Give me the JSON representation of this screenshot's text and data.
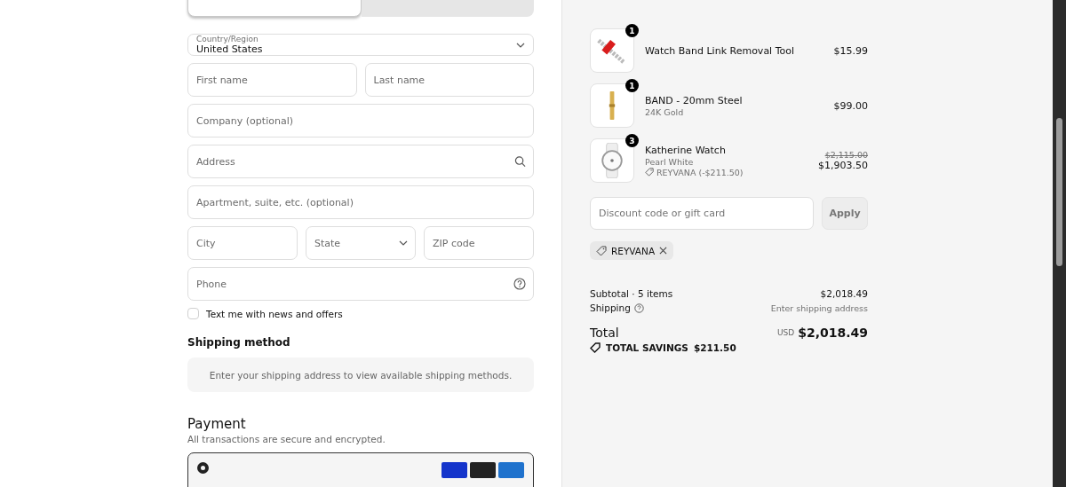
{
  "delivery_tabs": [
    {
      "selected": true
    },
    {
      "selected": false
    }
  ],
  "country": {
    "label": "Country/Region",
    "value": "United States"
  },
  "field_rows": [
    [
      {
        "kind": "text",
        "placeholder": "First name"
      },
      {
        "kind": "text",
        "placeholder": "Last name"
      }
    ],
    [
      {
        "kind": "text",
        "placeholder": "Company (optional)"
      }
    ],
    [
      {
        "kind": "search",
        "placeholder": "Address"
      }
    ],
    [
      {
        "kind": "text",
        "placeholder": "Apartment, suite, etc. (optional)"
      }
    ],
    [
      {
        "kind": "text",
        "placeholder": "City"
      },
      {
        "kind": "select",
        "placeholder": "State"
      },
      {
        "kind": "text",
        "placeholder": "ZIP code"
      }
    ],
    [
      {
        "kind": "help",
        "placeholder": "Phone"
      }
    ]
  ],
  "sms_opt_in": {
    "label": "Text me with news and offers",
    "checked": false
  },
  "shipping_method": {
    "heading": "Shipping method",
    "notice": "Enter your shipping address to view available shipping methods."
  },
  "payment": {
    "heading": "Payment",
    "subtitle": "All transactions are secure and encrypted.",
    "method_selected": true
  },
  "order_items": [
    {
      "kind": "tool",
      "quantity": "1",
      "name": "Watch Band Link Removal Tool",
      "price": "$15.99"
    },
    {
      "kind": "band",
      "quantity": "1",
      "name": "BAND - 20mm Steel",
      "variant": "24K Gold",
      "price": "$99.00"
    },
    {
      "kind": "watch",
      "quantity": "3",
      "name": "Katherine Watch",
      "variant": "Pearl White",
      "discount": "REYVANA (-$211.50)",
      "original_price": "$2,115.00",
      "price": "$1,903.50"
    }
  ],
  "discount": {
    "placeholder": "Discount code or gift card",
    "button": "Apply",
    "applied_code": "REYVANA"
  },
  "summary": {
    "subtotal_label": "Subtotal · 5 items",
    "subtotal": "$2,018.49",
    "shipping_label": "Shipping",
    "shipping": "Enter shipping address",
    "total_label": "Total",
    "currency": "USD",
    "total": "$2,018.49",
    "savings_label": "TOTAL SAVINGS",
    "savings": "$211.50"
  }
}
